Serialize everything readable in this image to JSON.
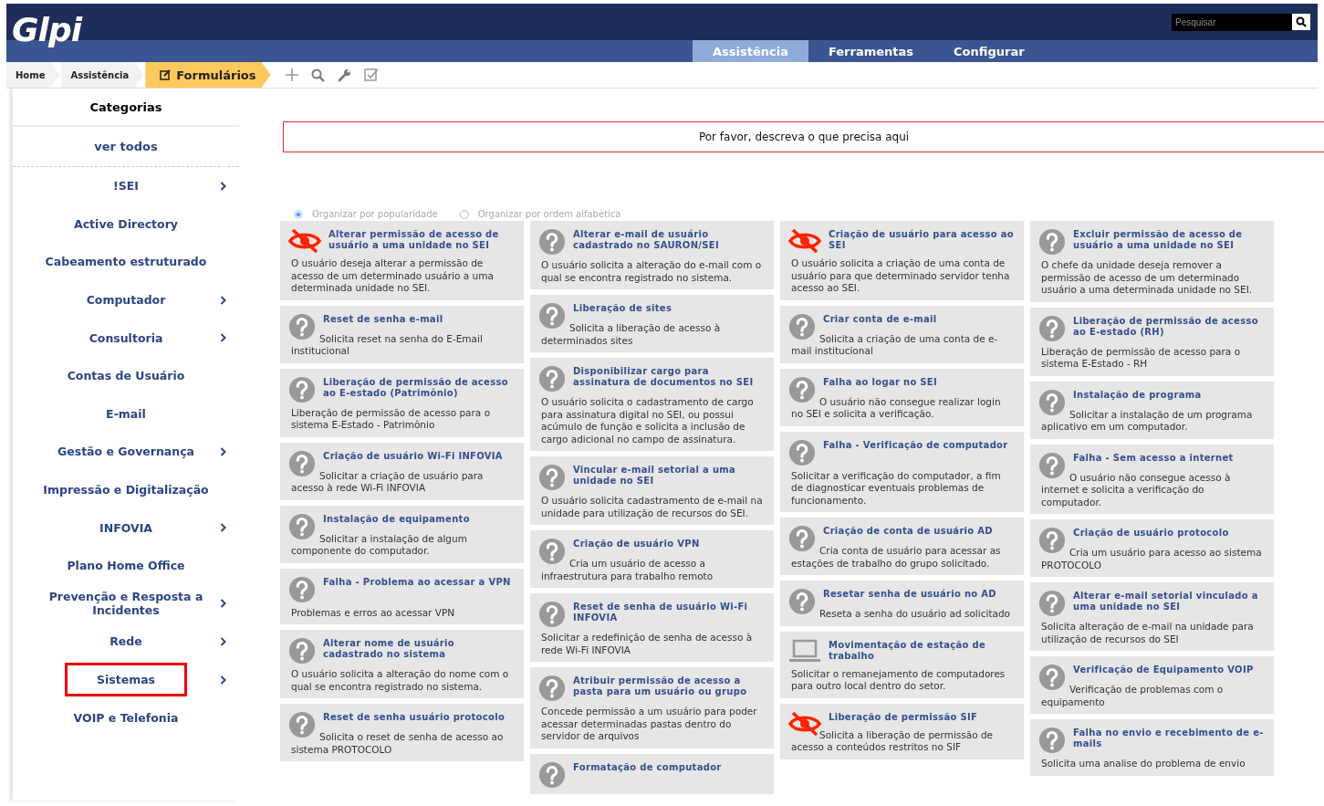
{
  "header": {
    "logo": "Glpi",
    "search": {
      "placeholder": "Pesquisar"
    },
    "menu": [
      {
        "label": "Assistência",
        "selected": true
      },
      {
        "label": "Ferramentas",
        "selected": false
      },
      {
        "label": "Configurar",
        "selected": false
      }
    ]
  },
  "breadcrumb": [
    {
      "label": "Home",
      "selected": false
    },
    {
      "label": "Assistência",
      "selected": false
    },
    {
      "label": "Formulários",
      "selected": true
    }
  ],
  "sidebar": {
    "title": "Categorias",
    "all": "ver todos",
    "items": [
      {
        "label": "!SEI",
        "has_children": true,
        "highlighted": false
      },
      {
        "label": "Active Directory",
        "has_children": false,
        "highlighted": false
      },
      {
        "label": "Cabeamento estruturado",
        "has_children": false,
        "highlighted": false
      },
      {
        "label": "Computador",
        "has_children": true,
        "highlighted": false
      },
      {
        "label": "Consultoria",
        "has_children": true,
        "highlighted": false
      },
      {
        "label": "Contas de Usuário",
        "has_children": false,
        "highlighted": false
      },
      {
        "label": "E-mail",
        "has_children": false,
        "highlighted": false
      },
      {
        "label": "Gestão e Governança",
        "has_children": true,
        "highlighted": false
      },
      {
        "label": "Impressão e Digitalização",
        "has_children": false,
        "highlighted": false
      },
      {
        "label": "INFOVIA",
        "has_children": true,
        "highlighted": false
      },
      {
        "label": "Plano Home Office",
        "has_children": false,
        "highlighted": false
      },
      {
        "label": "Prevenção e Resposta a Incidentes",
        "has_children": true,
        "highlighted": false
      },
      {
        "label": "Rede",
        "has_children": true,
        "highlighted": false
      },
      {
        "label": "Sistemas",
        "has_children": true,
        "highlighted": true
      },
      {
        "label": "VOIP e Telefonia",
        "has_children": false,
        "highlighted": false
      }
    ]
  },
  "search": {
    "placeholder": "Por favor, descreva o que precisa aqui"
  },
  "sort_options": [
    {
      "label": "Organizar por popularidade",
      "selected": true
    },
    {
      "label": "Organizar por ordem alfabética",
      "selected": false
    }
  ],
  "columns": [
    {
      "cards": [
        {
          "kind": "restricted",
          "title": "Alterar permissão de acesso de usuário a uma unidade no SEI",
          "description": "O usuário deseja alterar a permissão de acesso de um determinado usuário a uma determinada unidade no SEI.",
          "indented": false
        },
        {
          "kind": "question",
          "title": "Reset de senha e-mail",
          "description": "Solicita reset na senha do E-Email institucional",
          "indented": true
        },
        {
          "kind": "question",
          "title": "Liberação de permissão de acesso ao E-estado (Patrimônio)",
          "description": "Liberação de permissão de acesso para o sistema E-Estado - Patrimônio",
          "indented": false
        },
        {
          "kind": "question",
          "title": "Criação de usuário Wi-Fi INFOVIA",
          "description": "Solicitar a criação de usuário para acesso à rede Wi-Fi INFOVIA",
          "indented": true
        },
        {
          "kind": "question",
          "title": "Instalação de equipamento",
          "description": "Solicitar a instalação de algum componente do computador.",
          "indented": true
        },
        {
          "kind": "question",
          "title": "Falha - Problema ao acessar a VPN",
          "description": "Problemas e erros ao acessar VPN",
          "indented": false
        },
        {
          "kind": "question",
          "title": "Alterar nome de usuário cadastrado no sistema",
          "description": "O usuário solicita a alteração do nome com o qual se encontra registrado no sistema.",
          "indented": false
        },
        {
          "kind": "question",
          "title": "Reset de senha usuário protocolo",
          "description": "Solicita o reset de senha de acesso ao sistema PROTOCOLO",
          "indented": true
        }
      ]
    },
    {
      "cards": [
        {
          "kind": "question",
          "title": "Alterar e-mail de usuário cadastrado no SAURON/SEI",
          "description": "O usuário solicita a alteração do e-mail com o qual se encontra registrado no sistema.",
          "indented": false
        },
        {
          "kind": "question",
          "title": "Liberação de sites",
          "description": "Solicita a liberação de acesso à determinados sites",
          "indented": true
        },
        {
          "kind": "question",
          "title": "Disponibilizar cargo para assinatura de documentos no SEI",
          "description": "O usuário solicita o cadastramento de cargo para assinatura digital no SEI, ou possui acúmulo de função e solicita a inclusão de cargo adicional no campo de assinatura.",
          "indented": false
        },
        {
          "kind": "question",
          "title": "Vincular e-mail setorial a uma unidade no SEI",
          "description": "O usuário solicita cadastramento de e-mail na unidade para utilização de recursos do SEI.",
          "indented": false
        },
        {
          "kind": "question",
          "title": "Criação de usuário VPN",
          "description": "Cria um usuário de acesso a infraestrutura para trabalho remoto",
          "indented": true
        },
        {
          "kind": "question",
          "title": "Reset de senha de usuário Wi-Fi INFOVIA",
          "description": "Solicitar a redefinição de senha de acesso à rede Wi-Fi INFOVIA",
          "indented": false
        },
        {
          "kind": "question",
          "title": "Atribuir permissão de acesso a pasta para um usuário ou grupo",
          "description": "Concede permissão a um usuário para poder acessar determinadas pastas dentro do servidor de arquivos",
          "indented": false
        },
        {
          "kind": "question",
          "title": "Formatação de computador"
        }
      ]
    },
    {
      "cards": [
        {
          "kind": "restricted",
          "title": "Criação de usuário para acesso ao SEI",
          "description": "O usuário solicita a criação de uma conta de usuário para que determinado servidor tenha acesso ao SEI.",
          "indented": false
        },
        {
          "kind": "question",
          "title": "Criar conta de e-mail",
          "description": "Solicita a criação de uma conta de e-mail institucional",
          "indented": true
        },
        {
          "kind": "question",
          "title": "Falha ao logar no SEI",
          "description": "O usuário não consegue realizar login no SEI e solicita a verificação.",
          "indented": true
        },
        {
          "kind": "question",
          "title": "Falha - Verificação de computador",
          "description": "Solicitar a verificação do computador, a fim de diagnosticar eventuais problemas de funcionamento.",
          "indented": false
        },
        {
          "kind": "question",
          "title": "Criação de conta de usuário AD",
          "description": "Cria conta de usuário para acessar as estações de trabalho do grupo solicitado.",
          "indented": true
        },
        {
          "kind": "question",
          "title": "Resetar senha de usuário no AD",
          "description": "Reseta a senha do usuário ad solicitado",
          "indented": true
        },
        {
          "kind": "laptop",
          "title": "Movimentação de estação de trabalho",
          "description": "Solicitar o remanejamento de computadores para outro local dentro do setor.",
          "indented": false
        },
        {
          "kind": "restricted",
          "title": "Liberação de permissão SIF",
          "description": "Solicita a liberação de permissão de acesso a conteúdos restritos no SIF",
          "indented": true
        }
      ]
    },
    {
      "cards": [
        {
          "kind": "question",
          "title": "Excluir permissão de acesso de usuário a uma unidade no SEI",
          "description": "O chefe da unidade deseja remover a permissão de acesso de um determinado usuário a uma determinada unidade no SEI.",
          "indented": false
        },
        {
          "kind": "question",
          "title": "Liberação de permissão de acesso ao E-estado (RH)",
          "description": "Liberação de permissão de acesso para o sistema E-Estado - RH",
          "indented": false
        },
        {
          "kind": "question",
          "title": "Instalação de programa",
          "description": "Solicitar a instalação de um programa aplicativo em um computador.",
          "indented": true
        },
        {
          "kind": "question",
          "title": "Falha - Sem acesso a internet",
          "description": "O usuário não consegue acesso à internet e solicita a verificação do computador.",
          "indented": true
        },
        {
          "kind": "question",
          "title": "Criação de usuário protocolo",
          "description": "Cria um usuário para acesso ao sistema PROTOCOLO",
          "indented": true
        },
        {
          "kind": "question",
          "title": "Alterar e-mail setorial vinculado a uma unidade no SEI",
          "description": "Solicita alteração de e-mail na unidade para utilização de recursos do SEI",
          "indented": false
        },
        {
          "kind": "question",
          "title": "Verificação de Equipamento VOIP",
          "description": "Verificação de problemas com o equipamento",
          "indented": true
        },
        {
          "kind": "question",
          "title": "Falha no envio e recebimento de e-mails",
          "description": "Solicita uma analise do problema de envio",
          "indented": false
        }
      ]
    }
  ]
}
